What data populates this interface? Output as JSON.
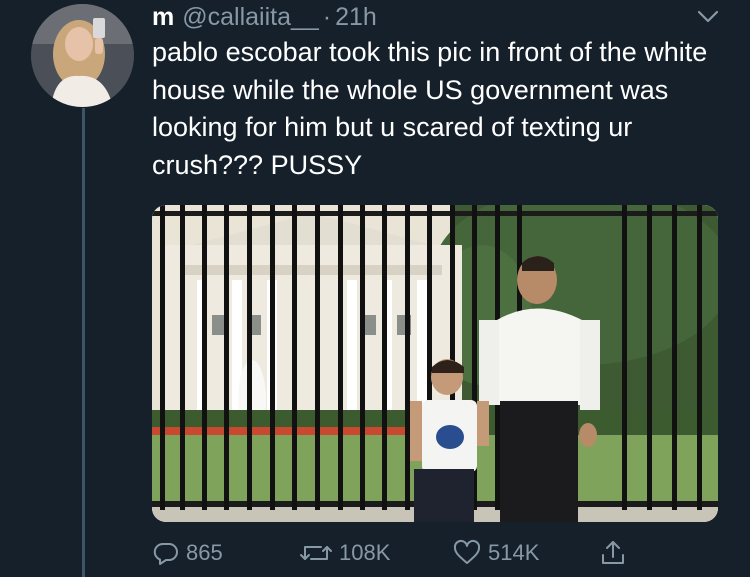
{
  "tweet": {
    "display_name": "m",
    "handle": "@callaiita__",
    "separator": "·",
    "time": "21h",
    "text": "pablo escobar took this pic in front of the white house while the whole US government was looking for him but u scared of texting ur crush??? PUSSY",
    "avatar_icon": "profile-photo",
    "menu_icon": "chevron-down-icon"
  },
  "actions": {
    "reply_count": "865",
    "retweet_count": "108K",
    "like_count": "514K",
    "share_icon": "share-icon"
  },
  "colors": {
    "background": "#15202b",
    "muted": "#8899a6",
    "thread_line": "#3d5466"
  }
}
